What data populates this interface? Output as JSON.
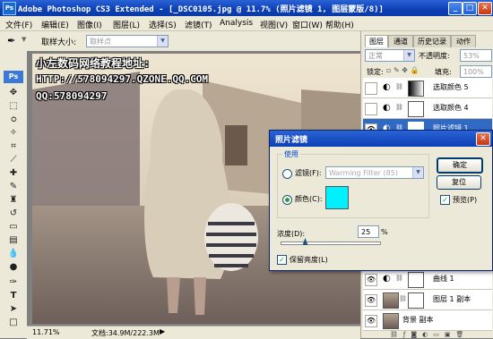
{
  "window": {
    "title": "Adobe Photoshop CS3 Extended - [_DSC0105.jpg @ 11.7% (照片滤镜 1, 图层蒙版/8)]",
    "app_icon_label": "Ps"
  },
  "menu": [
    "文件(F)",
    "编辑(E)",
    "图像(I)",
    "图层(L)",
    "选择(S)",
    "滤镜(T)",
    "Analysis",
    "视图(V)",
    "窗口(W)",
    "帮助(H)"
  ],
  "options_bar": {
    "sample_size_label": "取样大小:",
    "sample_size_value": "取样点"
  },
  "canvas": {
    "watermark_line1": "小左数码网络教程地址:",
    "watermark_line2": "HTTP://578094297.QZONE.QQ.COM",
    "watermark_line3": "QQ:578094297"
  },
  "status_bar": {
    "zoom": "11.71%",
    "doc_info": "文档:34.9M/222.3M"
  },
  "layers_panel": {
    "tabs": [
      "图层",
      "通道",
      "历史记录",
      "动作"
    ],
    "blend_mode": "正常",
    "opacity_label": "不透明度:",
    "opacity_value": "53%",
    "lock_label": "锁定:",
    "fill_label": "填充:",
    "fill_value": "100%",
    "layers_top": [
      {
        "name": "选取颜色 5"
      },
      {
        "name": "选取颜色 4"
      },
      {
        "name": "照片滤镜 1"
      }
    ],
    "layers_bottom": [
      {
        "name": "曲线 1"
      },
      {
        "name": "图层 1 副本"
      },
      {
        "name": "背景 副本"
      }
    ]
  },
  "dialog": {
    "title": "照片滤镜",
    "group_label": "使用",
    "filter_label": "滤镜(F):",
    "filter_value": "Warming Filter (85)",
    "color_label": "颜色(C):",
    "color_swatch": "#00f0ff",
    "density_label": "浓度(D):",
    "density_value": "25",
    "density_unit": "%",
    "density_level_percent": 25,
    "preserve_label": "保留亮度(L)",
    "ok_label": "确定",
    "cancel_label": "复位",
    "preview_label": "预览(P)"
  }
}
